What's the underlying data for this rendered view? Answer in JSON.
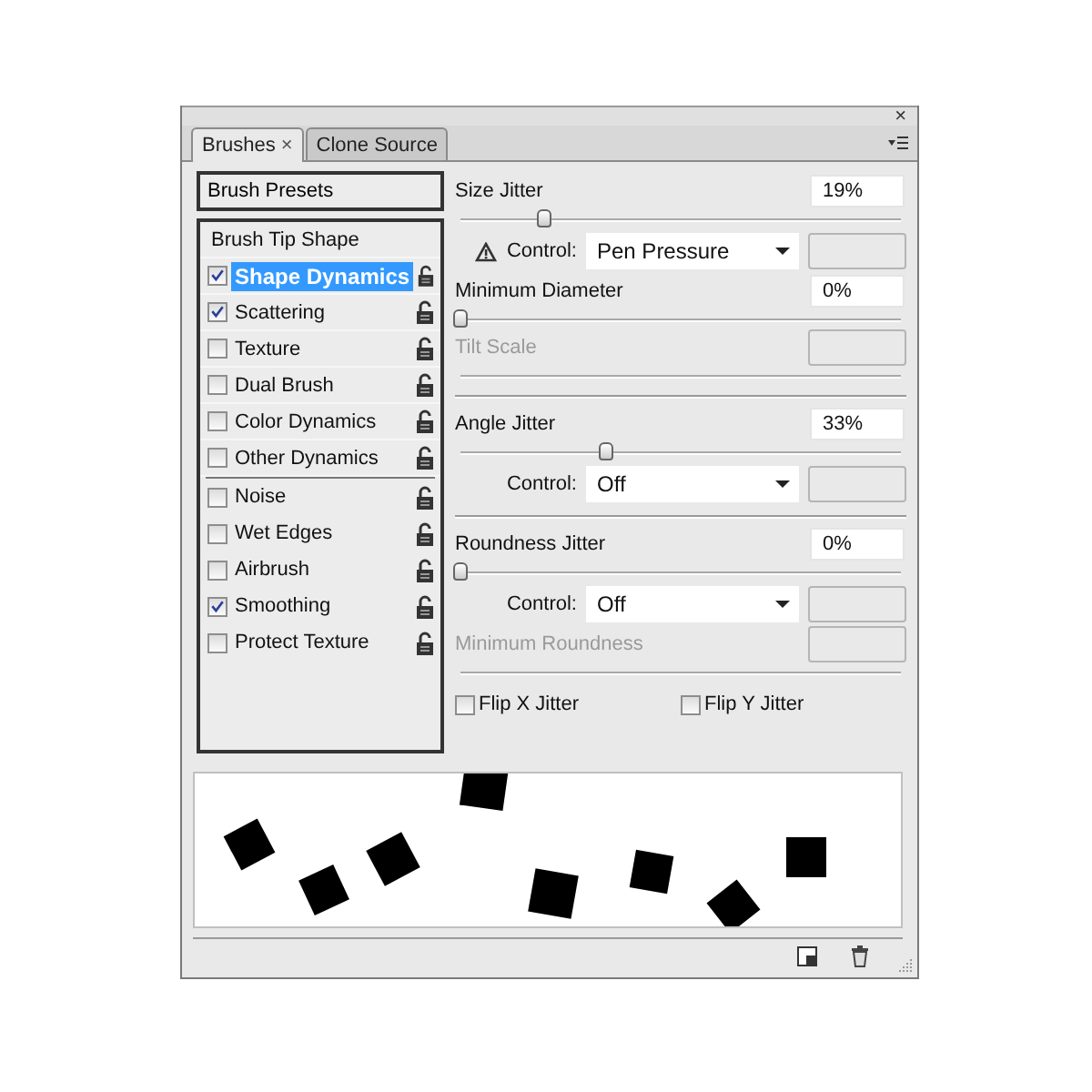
{
  "window": {
    "close_glyph": "×"
  },
  "tabs": [
    {
      "label": "Brushes",
      "closable": true,
      "selected": true
    },
    {
      "label": "Clone Source",
      "closable": false,
      "selected": false
    }
  ],
  "tab_close_glyph": "×",
  "sidebar": {
    "presets": "Brush Presets",
    "groups": [
      {
        "items": [
          {
            "kind": "heading",
            "label": "Brush Tip Shape",
            "selected": false
          },
          {
            "kind": "option",
            "label": "Shape Dynamics",
            "checked": true,
            "selected": true
          },
          {
            "kind": "option",
            "label": "Scattering",
            "checked": true,
            "selected": false
          },
          {
            "kind": "option",
            "label": "Texture",
            "checked": false,
            "selected": false
          },
          {
            "kind": "option",
            "label": "Dual Brush",
            "checked": false,
            "selected": false
          },
          {
            "kind": "option",
            "label": "Color Dynamics",
            "checked": false,
            "selected": false
          },
          {
            "kind": "option",
            "label": "Other Dynamics",
            "checked": false,
            "selected": false
          }
        ]
      },
      {
        "items": [
          {
            "kind": "option",
            "label": "Noise",
            "checked": false,
            "selected": false
          },
          {
            "kind": "option",
            "label": "Wet Edges",
            "checked": false,
            "selected": false
          },
          {
            "kind": "option",
            "label": "Airbrush",
            "checked": false,
            "selected": false
          },
          {
            "kind": "option",
            "label": "Smoothing",
            "checked": true,
            "selected": false
          },
          {
            "kind": "option",
            "label": "Protect Texture",
            "checked": false,
            "selected": false
          }
        ]
      }
    ]
  },
  "settings": {
    "rows": [
      {
        "kind": "slider",
        "label": "Size Jitter",
        "value": "19%",
        "level": 0.19,
        "disabled": false
      },
      {
        "kind": "control",
        "label": "Control:",
        "value": "Pen Pressure",
        "warning": true
      },
      {
        "kind": "slider",
        "label": "Minimum Diameter",
        "value": "0%",
        "level": 0,
        "disabled": false
      },
      {
        "kind": "slider",
        "label": "Tilt Scale",
        "disabled": true
      },
      {
        "kind": "divider"
      },
      {
        "kind": "slider",
        "label": "Angle Jitter",
        "value": "33%",
        "level": 0.33,
        "disabled": false
      },
      {
        "kind": "control",
        "label": "Control:",
        "value": "Off",
        "warning": false
      },
      {
        "kind": "divider"
      },
      {
        "kind": "slider",
        "label": "Roundness Jitter",
        "value": "0%",
        "level": 0,
        "disabled": false
      },
      {
        "kind": "control",
        "label": "Control:",
        "value": "Off",
        "warning": false
      },
      {
        "kind": "slider",
        "label": "Minimum Roundness",
        "disabled": true
      },
      {
        "kind": "checks",
        "items": [
          {
            "label": "Flip X Jitter",
            "checked": false
          },
          {
            "label": "Flip Y Jitter",
            "checked": false
          }
        ]
      }
    ]
  }
}
